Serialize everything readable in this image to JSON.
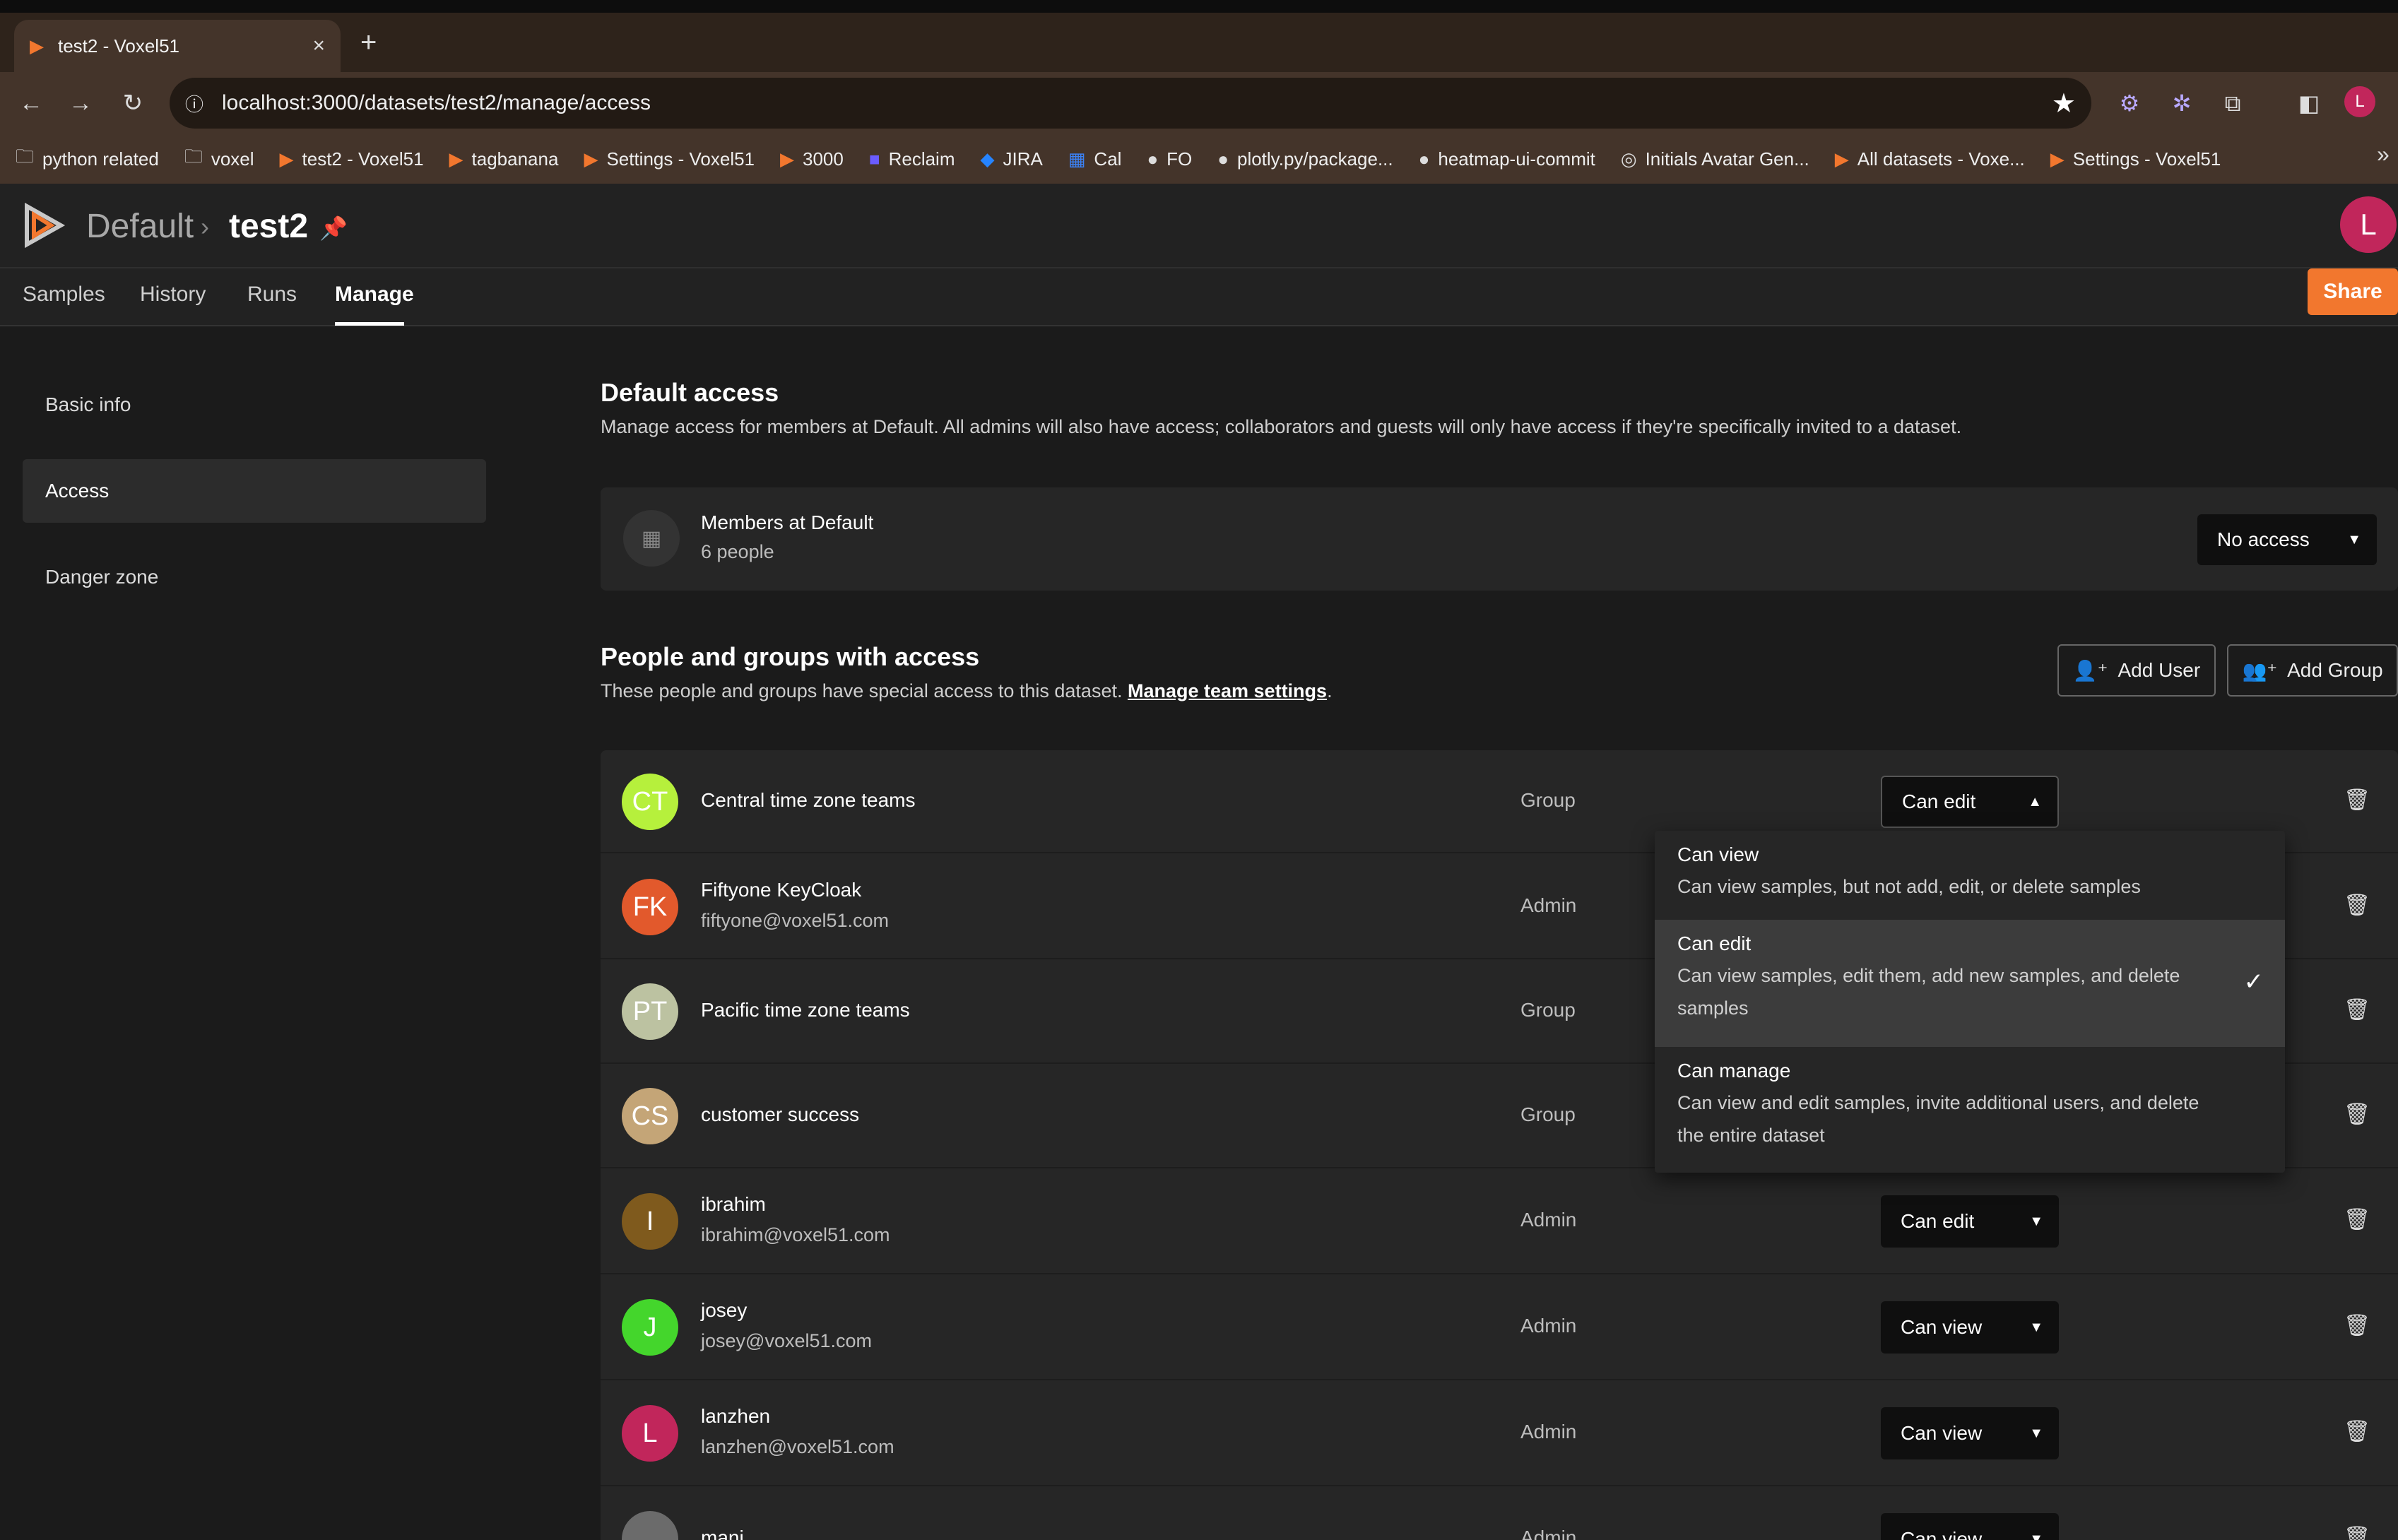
{
  "browser": {
    "tab_title": "test2 - Voxel51",
    "close": "×",
    "new_tab": "+",
    "url": "localhost:3000/datasets/test2/manage/access",
    "bookmarks": [
      {
        "label": "python related",
        "icon": "folder-icon"
      },
      {
        "label": "voxel",
        "icon": "folder-icon"
      },
      {
        "label": "test2 - Voxel51",
        "icon": "voxel-icon"
      },
      {
        "label": "tagbanana",
        "icon": "voxel-icon"
      },
      {
        "label": "Settings - Voxel51",
        "icon": "voxel-icon"
      },
      {
        "label": "3000",
        "icon": "voxel-icon"
      },
      {
        "label": "Reclaim",
        "icon": "reclaim-icon"
      },
      {
        "label": "JIRA",
        "icon": "jira-icon"
      },
      {
        "label": "Cal",
        "icon": "calendar-icon"
      },
      {
        "label": "FO",
        "icon": "github-icon"
      },
      {
        "label": "plotly.py/package...",
        "icon": "github-icon"
      },
      {
        "label": "heatmap-ui-commit",
        "icon": "github-icon"
      },
      {
        "label": "Initials Avatar Gen...",
        "icon": "web-icon"
      },
      {
        "label": "All datasets - Voxe...",
        "icon": "voxel-icon"
      },
      {
        "label": "Settings - Voxel51",
        "icon": "voxel-icon"
      }
    ],
    "more": "»",
    "profile_initial": "L"
  },
  "header": {
    "org": "Default",
    "dataset": "test2",
    "user_initial": "L"
  },
  "tabs": [
    "Samples",
    "History",
    "Runs",
    "Manage"
  ],
  "share_label": "Share",
  "sidebar": [
    "Basic info",
    "Access",
    "Danger zone"
  ],
  "default_access": {
    "title": "Default access",
    "description": "Manage access for members at Default. All admins will also have access; collaborators and guests will only have access if they're specifically invited to a dataset.",
    "members_title": "Members at Default",
    "members_count": "6 people",
    "level": "No access"
  },
  "people": {
    "title": "People and groups with access",
    "description": "These people and groups have special access to this dataset.",
    "link": "Manage team settings",
    "period": ".",
    "add_user": "Add User",
    "add_group": "Add Group",
    "rows": [
      {
        "initials": "CT",
        "name": "Central time zone teams",
        "email": "",
        "role": "Group",
        "access": "Can edit",
        "color": "#b6f03c"
      },
      {
        "initials": "FK",
        "name": "Fiftyone KeyCloak",
        "email": "fiftyone@voxel51.com",
        "role": "Admin",
        "access": "",
        "color": "#e2592c"
      },
      {
        "initials": "PT",
        "name": "Pacific time zone teams",
        "email": "",
        "role": "Group",
        "access": "",
        "color": "#bcc2a1"
      },
      {
        "initials": "CS",
        "name": "customer success",
        "email": "",
        "role": "Group",
        "access": "",
        "color": "#c4a577"
      },
      {
        "initials": "I",
        "name": "ibrahim",
        "email": "ibrahim@voxel51.com",
        "role": "Admin",
        "access": "Can edit",
        "color": "#7f5a1d"
      },
      {
        "initials": "J",
        "name": "josey",
        "email": "josey@voxel51.com",
        "role": "Admin",
        "access": "Can view",
        "color": "#44d62c"
      },
      {
        "initials": "L",
        "name": "lanzhen",
        "email": "lanzhen@voxel51.com",
        "role": "Admin",
        "access": "Can view",
        "color": "#c1265b"
      },
      {
        "initials": "",
        "name": "mani",
        "email": "",
        "role": "Admin",
        "access": "Can view",
        "color": "#6b6b6b"
      }
    ]
  },
  "menu": [
    {
      "title": "Can view",
      "desc": "Can view samples, but not add, edit, or delete samples",
      "selected": false
    },
    {
      "title": "Can edit",
      "desc": "Can view samples, edit them, add new samples, and delete samples",
      "selected": true
    },
    {
      "title": "Can manage",
      "desc": "Can view and edit samples, invite additional users, and delete the entire dataset",
      "selected": false
    }
  ],
  "colors": {
    "accent": "#f2772e",
    "bg": "#1b1b1b",
    "panel": "#262626"
  }
}
